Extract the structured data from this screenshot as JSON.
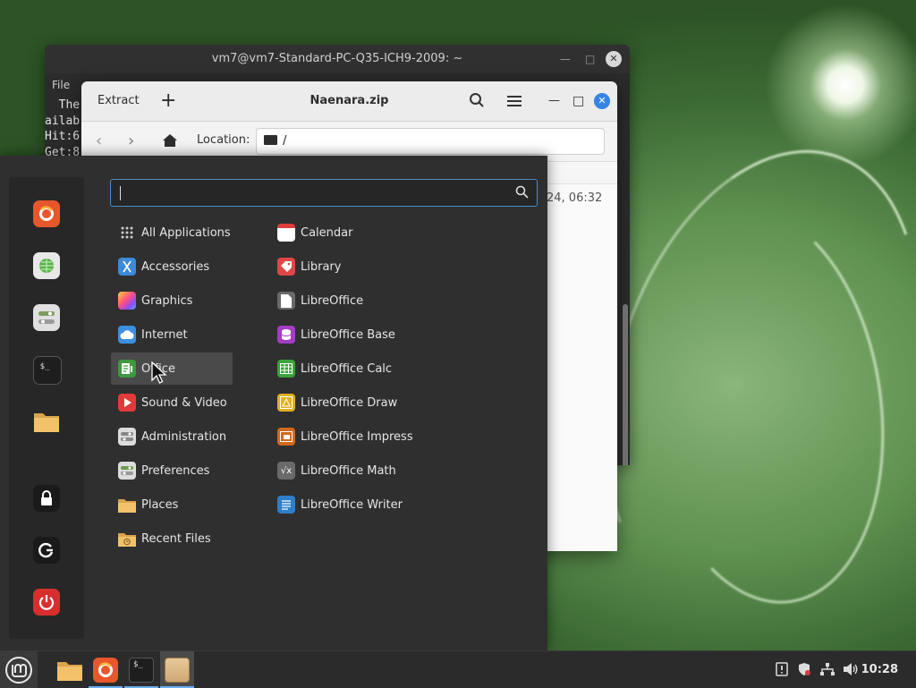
{
  "terminal": {
    "title": "vm7@vm7-Standard-PC-Q35-ICH9-2009: ~",
    "menu_file": "File",
    "lines": [
      "  The",
      "ailab",
      "Hit:6",
      "Get:8"
    ]
  },
  "archive": {
    "extract_label": "Extract",
    "title": "Naenara.zip",
    "location_label": "Location:",
    "location_value": "/",
    "row_fragment": "24, 06:32"
  },
  "menu": {
    "search_placeholder": "",
    "favorites": [
      "firefox-icon",
      "network-icon",
      "settings-icon",
      "terminal-icon",
      "files-icon"
    ],
    "session": [
      "lock-icon",
      "logout-icon",
      "shutdown-icon"
    ],
    "categories": [
      {
        "label": "All Applications",
        "icon": "grid-icon"
      },
      {
        "label": "Accessories",
        "icon": "accessories-icon"
      },
      {
        "label": "Graphics",
        "icon": "graphics-icon"
      },
      {
        "label": "Internet",
        "icon": "internet-icon"
      },
      {
        "label": "Office",
        "icon": "office-icon",
        "selected": true
      },
      {
        "label": "Sound & Video",
        "icon": "sound-video-icon"
      },
      {
        "label": "Administration",
        "icon": "administration-icon"
      },
      {
        "label": "Preferences",
        "icon": "preferences-icon"
      },
      {
        "label": "Places",
        "icon": "folder-icon"
      },
      {
        "label": "Recent Files",
        "icon": "recent-files-icon"
      }
    ],
    "apps": [
      {
        "label": "Calendar",
        "icon": "calendar-icon"
      },
      {
        "label": "Library",
        "icon": "library-icon"
      },
      {
        "label": "LibreOffice",
        "icon": "libreoffice-icon"
      },
      {
        "label": "LibreOffice Base",
        "icon": "libreoffice-base-icon"
      },
      {
        "label": "LibreOffice Calc",
        "icon": "libreoffice-calc-icon"
      },
      {
        "label": "LibreOffice Draw",
        "icon": "libreoffice-draw-icon"
      },
      {
        "label": "LibreOffice Impress",
        "icon": "libreoffice-impress-icon"
      },
      {
        "label": "LibreOffice Math",
        "icon": "libreoffice-math-icon"
      },
      {
        "label": "LibreOffice Writer",
        "icon": "libreoffice-writer-icon"
      }
    ]
  },
  "taskbar": {
    "clock": "10:28",
    "launchers": [
      "files-icon",
      "firefox-icon",
      "terminal-icon",
      "archive-manager-icon"
    ]
  },
  "colors": {
    "accent": "#4a8ec8",
    "selected_bg": "#4a4a4a",
    "menu_bg": "#2f2f2f",
    "taskbar_bg": "#2b2b2b"
  }
}
